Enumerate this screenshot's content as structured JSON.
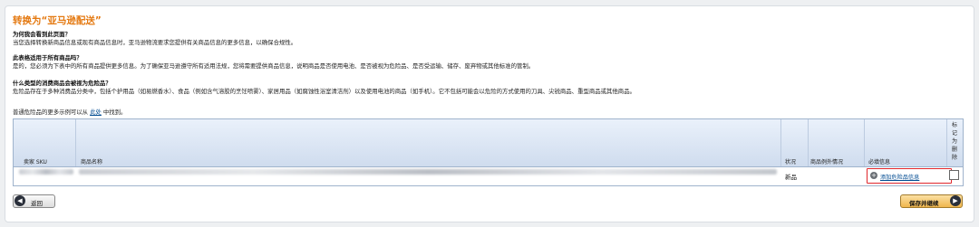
{
  "page": {
    "title": "转换为“亚马逊配送”"
  },
  "faq": [
    {
      "q": "为何我会看到此页面？",
      "a": "当您选择转换新商品信息或现有商品信息时，亚马逊物流要求您提供有关商品信息的更多信息，以确保合规性。"
    },
    {
      "q": "此表格适用于所有商品吗？",
      "a": "是的，您必须为下表中的所有商品提供更多信息。为了确保亚马逊遵守所有适用法规，您将需要提供商品信息，说明商品是否使用电池、是否被视为危险品、是否受运输、储存、废弃物或其他标准的管制。"
    },
    {
      "q": "什么类型的消费商品会被视为危险品？",
      "a": "危险品存在于多种消费品分类中，包括个护用品（如易燃香水）、食品（例如含气溶胶的烹饪喷雾）、家居用品（如腐蚀性浴室清洁剂）以及使用电池的商品（如手机）。它不包括可能会以危险的方式使用的刀具、尖锐商品、重型商品或其他商品。"
    }
  ],
  "more": {
    "prefix": "普通危险品的更多示例可以从",
    "link": "此处",
    "suffix": "中找到。"
  },
  "table": {
    "headers": {
      "sku": "卖家 SKU",
      "name": "商品名称",
      "condition": "状况",
      "exception": "商品例外情况",
      "required": "必填信息",
      "mark_delete": "标记为删除"
    },
    "rows": [
      {
        "condition": "新品",
        "action_label": "添加危险品信息",
        "action_icon": "plus-circle-icon",
        "mark_delete": false
      }
    ]
  },
  "buttons": {
    "back": "返回",
    "save": "保存并继续"
  },
  "colors": {
    "title": "#e47911",
    "link": "#004b91",
    "highlight": "#e0262b",
    "save_button": "#f0b64d"
  }
}
